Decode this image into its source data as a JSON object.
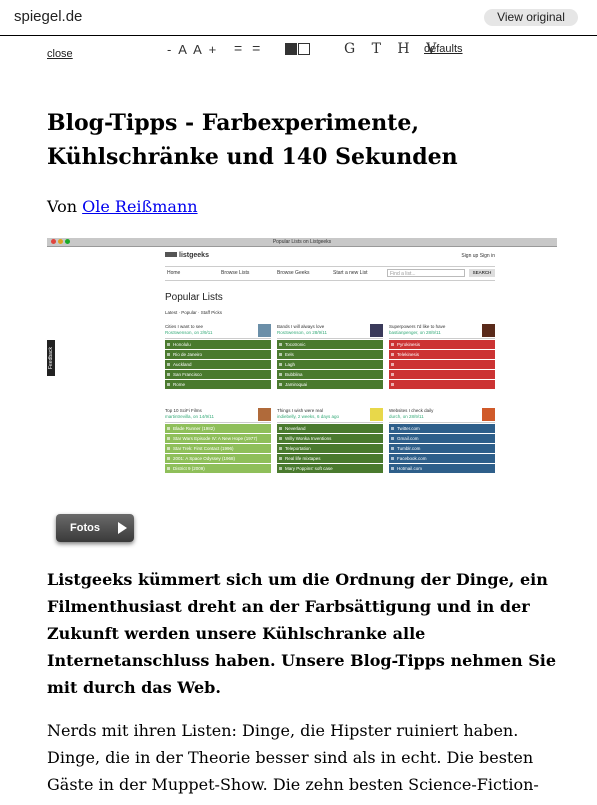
{
  "header": {
    "site": "spiegel.de",
    "view_original": "View original"
  },
  "toolbar": {
    "close": "close",
    "font_size": "- A A +",
    "line_spacing": "= =",
    "fonts": "G T H V",
    "defaults": "defaults"
  },
  "article": {
    "title": "Blog-Tipps - Farbexperimente, Kühlschränke und 140 Sekunden",
    "byline_prefix": "Von",
    "author": "Ole Reißmann",
    "fotos_label": "Fotos",
    "lead": "Listgeeks kümmert sich um die Ordnung der Dinge, ein Filmenthusiast dreht an der Farbsättigung und in der Zukunft werden unsere Kühlschranke alle Internetanschluss haben. Unsere Blog-Tipps nehmen Sie mit durch das Web.",
    "body": "Nerds mit ihren Listen: Dinge, die Hipster ruiniert haben. Dinge, die in der Theorie besser sind als in echt. Die besten Gäste in der Muppet-Show. Die zehn besten Science-Fiction-"
  },
  "screenshot": {
    "window_title": "Popular Lists on Listgeeks",
    "logo": "listgeeks",
    "sign": "Sign up   Sign in",
    "nav": [
      "Home",
      "Browse Lists",
      "Browse Geeks",
      "Start a new List"
    ],
    "search_placeholder": "Find a list...",
    "search_button": "SEARCH",
    "heading": "Popular Lists",
    "tabs": "Latest · Popular · Staff Picks",
    "feedback": "Feedback",
    "cards": [
      {
        "title": "Cities I want to see",
        "sub": "RosSwenson, on 2/9/11",
        "color": "#4a7a2e",
        "rows": [
          "Honolulu",
          "Rio de Janeiro",
          "Auckland",
          "San Francisco",
          "Rome"
        ]
      },
      {
        "title": "Bands I will always love",
        "sub": "RosSwenson, on 28/9/11",
        "color": "#4a7a2e",
        "rows": [
          "Tocotronic",
          "Eels",
          "Lagh",
          "Bubblina",
          "Jamiroquai"
        ]
      },
      {
        "title": "Superpowers I'd like to have",
        "sub": "bastianpenger, on 28/9/11",
        "color": "#cc3333",
        "rows": [
          "Pyrokinesis",
          "Telekinesis",
          "",
          "",
          ""
        ]
      },
      {
        "title": "Top 10 SciFi Films",
        "sub": "martintrevilla, on 14/9/11",
        "color": "#8fbf5a",
        "rows": [
          "Blade Runner (1982)",
          "Star Wars Episode IV: A New Hope (1977)",
          "Star Trek: First Contact (1996)",
          "2001: A Space Odyssey (1968)",
          "District 9 (2009)"
        ]
      },
      {
        "title": "Things I wish were real",
        "sub": "indiebelly, 2 weeks, 6 days ago",
        "color": "#4a7a2e",
        "rows": [
          "Neverland",
          "Willy Wonka Inventions",
          "Teleportation",
          "Real life mixtapes",
          "Mary Poppins' soft case"
        ]
      },
      {
        "title": "Websites I check daily",
        "sub": "durch, on 28/9/11",
        "color": "#2e5f8a",
        "rows": [
          "Twitter.com",
          "Gmail.com",
          "Tumblr.com",
          "Facebook.com",
          "Hotmail.com"
        ]
      }
    ]
  }
}
